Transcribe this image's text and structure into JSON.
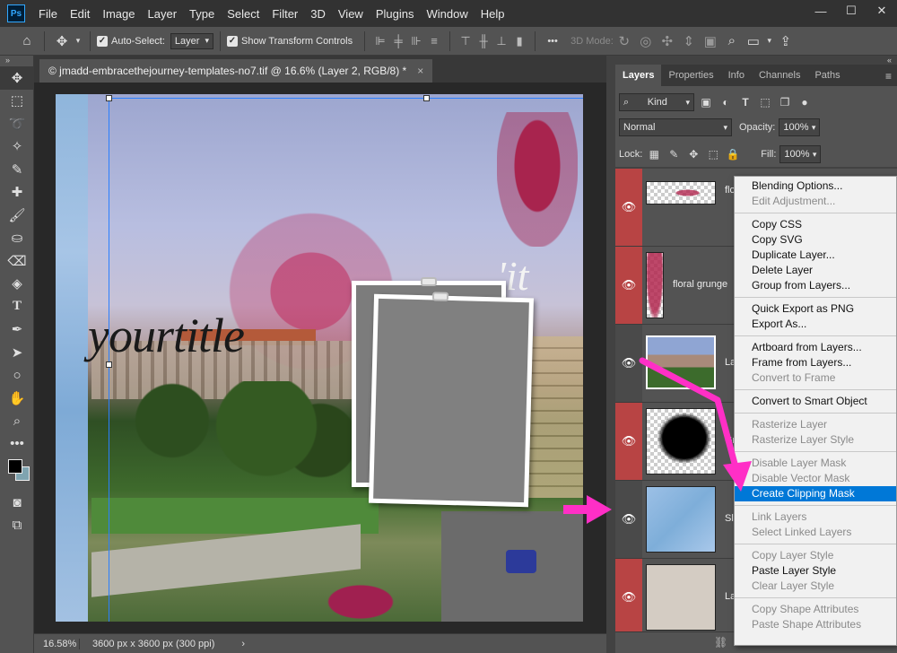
{
  "menubar": {
    "logo": "Ps",
    "items": [
      "File",
      "Edit",
      "Image",
      "Layer",
      "Type",
      "Select",
      "Filter",
      "3D",
      "View",
      "Plugins",
      "Window",
      "Help"
    ],
    "window_controls": [
      "—",
      "☐",
      "✕"
    ]
  },
  "options_bar": {
    "auto_select_label": "Auto-Select:",
    "auto_select_value": "Layer",
    "show_transform_label": "Show Transform Controls",
    "mode_3d_label": "3D Mode:",
    "more_label": "•••"
  },
  "document": {
    "tab_title": "© jmadd-embracethejourney-templates-no7.tif @ 16.6% (Layer 2, RGB/8) *",
    "tab_close": "×",
    "title_word_1": "your",
    "title_word_2": "title",
    "it_text": "'it"
  },
  "status_bar": {
    "zoom": "16.58%",
    "doc_info": "3600 px x 3600 px (300 ppi)",
    "arrow": "›"
  },
  "panels": {
    "tabs": [
      "Layers",
      "Properties",
      "Info",
      "Channels",
      "Paths"
    ],
    "active_tab": "Layers",
    "filter_kind": "Kind",
    "blend_mode": "Normal",
    "opacity_label": "Opacity:",
    "opacity_value": "100%",
    "lock_label": "Lock:",
    "fill_label": "Fill:",
    "fill_value": "100%"
  },
  "layers": [
    {
      "name": "flo",
      "eye_color": "red",
      "thumb": "checker-magenta"
    },
    {
      "name": "floral grunge",
      "eye_color": "red",
      "thumb": "checker-magenta-narrow"
    },
    {
      "name": "La",
      "eye_color": "plain",
      "thumb": "photo"
    },
    {
      "name": "Gr",
      "eye_color": "red",
      "thumb": "checker-black"
    },
    {
      "name": "Sl",
      "eye_color": "plain",
      "thumb": "watercolor-blue"
    },
    {
      "name": "La",
      "eye_color": "red",
      "thumb": "beige"
    }
  ],
  "context_menu": {
    "groups": [
      [
        {
          "label": "Blending Options...",
          "enabled": true
        },
        {
          "label": "Edit Adjustment...",
          "enabled": false
        }
      ],
      [
        {
          "label": "Copy CSS",
          "enabled": true
        },
        {
          "label": "Copy SVG",
          "enabled": true
        },
        {
          "label": "Duplicate Layer...",
          "enabled": true
        },
        {
          "label": "Delete Layer",
          "enabled": true
        },
        {
          "label": "Group from Layers...",
          "enabled": true
        }
      ],
      [
        {
          "label": "Quick Export as PNG",
          "enabled": true
        },
        {
          "label": "Export As...",
          "enabled": true
        }
      ],
      [
        {
          "label": "Artboard from Layers...",
          "enabled": true
        },
        {
          "label": "Frame from Layers...",
          "enabled": true
        },
        {
          "label": "Convert to Frame",
          "enabled": false
        }
      ],
      [
        {
          "label": "Convert to Smart Object",
          "enabled": true
        }
      ],
      [
        {
          "label": "Rasterize Layer",
          "enabled": false
        },
        {
          "label": "Rasterize Layer Style",
          "enabled": false
        }
      ],
      [
        {
          "label": "Disable Layer Mask",
          "enabled": false
        },
        {
          "label": "Disable Vector Mask",
          "enabled": false
        },
        {
          "label": "Create Clipping Mask",
          "enabled": true,
          "highlighted": true
        }
      ],
      [
        {
          "label": "Link Layers",
          "enabled": false
        },
        {
          "label": "Select Linked Layers",
          "enabled": false
        }
      ],
      [
        {
          "label": "Copy Layer Style",
          "enabled": false
        },
        {
          "label": "Paste Layer Style",
          "enabled": true
        },
        {
          "label": "Clear Layer Style",
          "enabled": false
        }
      ],
      [
        {
          "label": "Copy Shape Attributes",
          "enabled": false
        },
        {
          "label": "Paste Shape Attributes",
          "enabled": false
        }
      ]
    ]
  },
  "colors": {
    "highlight": "#0078d7",
    "annotation_arrow": "#ff2fc6",
    "eye_red": "#b84444"
  }
}
